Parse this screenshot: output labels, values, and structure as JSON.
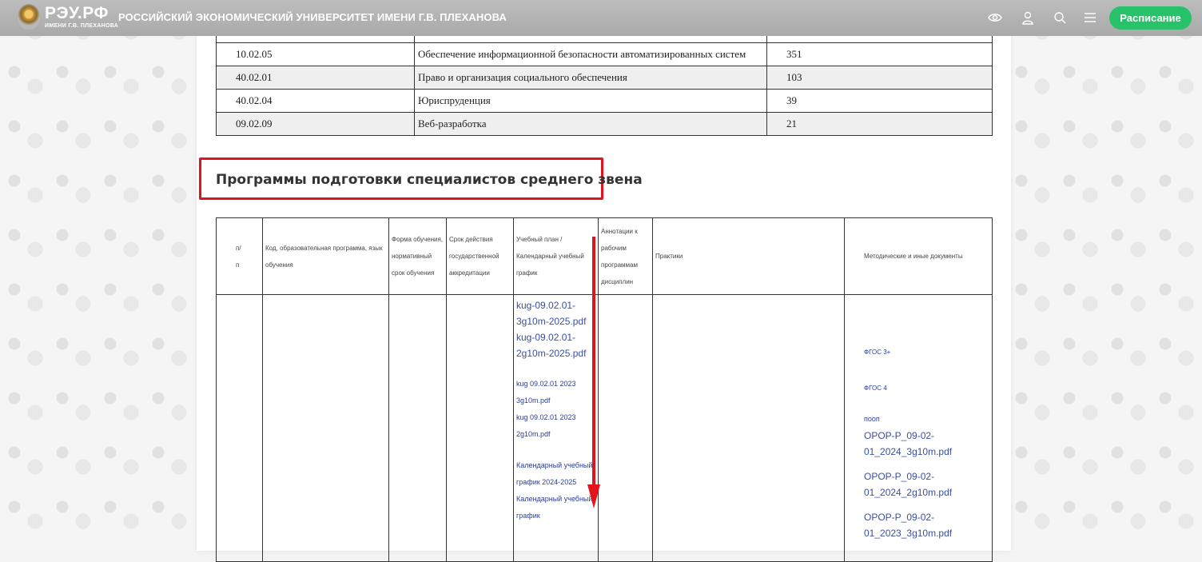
{
  "header": {
    "logo_text": "РЭУ.РФ",
    "logo_sub": "ИМЕНИ Г.В. ПЛЕХАНОВА",
    "university_name": "РОССИЙСКИЙ ЭКОНОМИЧЕСКИЙ УНИВЕРСИТЕТ ИМЕНИ Г.В. ПЛЕХАНОВА",
    "icons": [
      "eye-icon",
      "user-icon",
      "search-icon",
      "menu-icon"
    ],
    "schedule_button": "Расписание",
    "accent_color": "#27c26a"
  },
  "programs_table": {
    "rows": [
      {
        "code": "10.02.05",
        "name": "Обеспечение информационной безопасности автоматизированных систем",
        "count": "351"
      },
      {
        "code": "40.02.01",
        "name": "Право и организация социального обеспечения",
        "count": "103"
      },
      {
        "code": "40.02.04",
        "name": "Юриспруденция",
        "count": "39"
      },
      {
        "code": "09.02.09",
        "name": "Веб-разработка",
        "count": "21"
      }
    ]
  },
  "section": {
    "title": "Программы подготовки специалистов среднего звена",
    "highlight_color": "#e3131b"
  },
  "docs_table": {
    "headers": {
      "num_a": "п/",
      "num_b": "п",
      "program": "Код, образовательная программа, язык обучения",
      "form": "Форма обучения, нормативный срок обучения",
      "accreditation": "Срок действия государственной аккредитации",
      "plan": "Учебный план / Календарный учебный график",
      "annotations": "Аннотации к рабочим программам дисциплин",
      "practice": "Практики",
      "methodical": "Методические и иные документы"
    },
    "plan_links": {
      "big": [
        "kug-09.02.01-3g10m-2025.pdf",
        "kug-09.02.01-2g10m-2025.pdf"
      ],
      "small": [
        "kug 09.02.01 2023 3g10m.pdf",
        "kug 09.02.01 2023 2g10m.pdf"
      ],
      "calendar": [
        "Календарный учебный график 2024-2025",
        "Календарный учебный график"
      ]
    },
    "methodical_links": {
      "fgos": [
        "ФГОС 3+",
        "ФГОС 4"
      ],
      "poop_label": "пооп",
      "files": [
        "OPOP-P_09-02-01_2024_3g10m.pdf",
        "OPOP-P_09-02-01_2024_2g10m.pdf",
        "OPOP-P_09-02-01_2023_3g10m.pdf"
      ]
    }
  }
}
